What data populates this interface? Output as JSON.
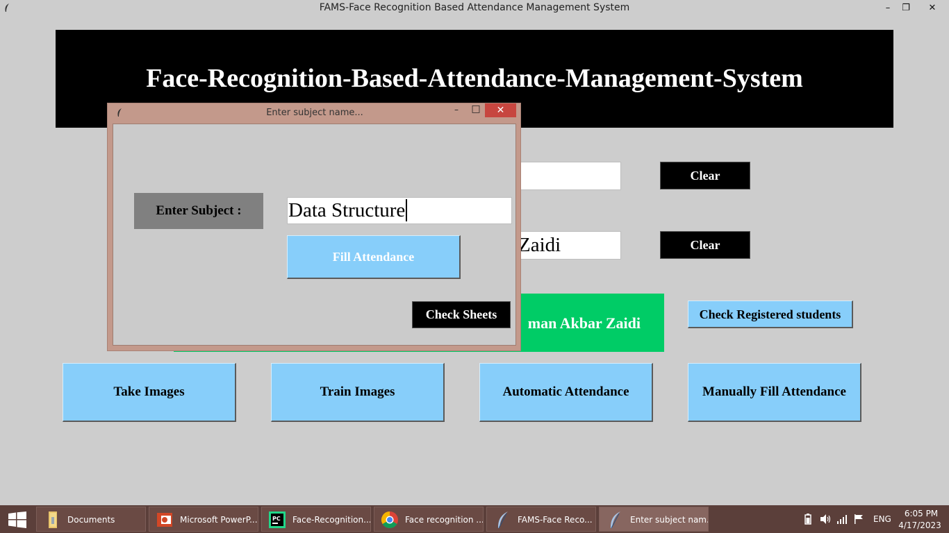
{
  "window": {
    "title": "FAMS-Face Recognition Based Attendance Management System",
    "minimize": "–",
    "restore": "❐",
    "close": "✕"
  },
  "banner": {
    "title": "Face-Recognition-Based-Attendance-Management-System"
  },
  "main": {
    "field1_value": "",
    "field2_value": "Zaidi",
    "clear1": "Clear",
    "clear2": "Clear",
    "notification": "man Akbar Zaidi",
    "check_registered": "Check Registered students",
    "buttons": {
      "take_images": "Take Images",
      "train_images": "Train Images",
      "automatic_attendance": "Automatic Attendance",
      "manual_attendance": "Manually Fill Attendance"
    }
  },
  "dialog": {
    "title": "Enter subject name...",
    "minimize": "–",
    "maximize": "□",
    "close": "✕",
    "label": "Enter Subject :",
    "subject_value": "Data Structure",
    "fill_button": "Fill Attendance",
    "check_sheets": "Check Sheets"
  },
  "taskbar": {
    "items": [
      {
        "label": "Documents",
        "icon": "folder-icon"
      },
      {
        "label": "Microsoft PowerP...",
        "icon": "powerpoint-icon"
      },
      {
        "label": "Face-Recognition...",
        "icon": "pycharm-icon"
      },
      {
        "label": "Face recognition ...",
        "icon": "chrome-icon"
      },
      {
        "label": "FAMS-Face Reco...",
        "icon": "feather-icon"
      },
      {
        "label": "Enter subject nam...",
        "icon": "feather-icon"
      }
    ],
    "lang": "ENG",
    "time": "6:05 PM",
    "date": "4/17/2023"
  }
}
